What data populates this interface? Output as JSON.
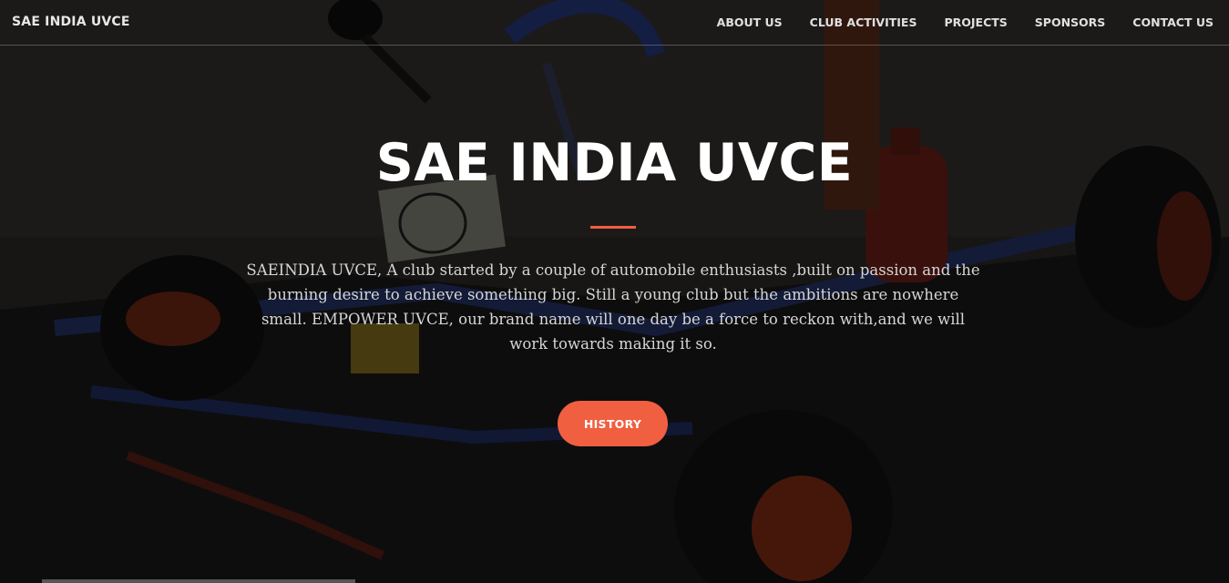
{
  "navbar": {
    "brand": "SAE INDIA UVCE",
    "links": [
      {
        "label": "ABOUT US"
      },
      {
        "label": "CLUB ACTIVITIES"
      },
      {
        "label": "PROJECTS"
      },
      {
        "label": "SPONSORS"
      },
      {
        "label": "CONTACT US"
      }
    ]
  },
  "hero": {
    "title": "SAE INDIA UVCE",
    "description": "SAEINDIA UVCE, A club started by a couple of automobile enthusiasts ,built on passion and the burning desire to achieve something big. Still a young club but the ambitions are nowhere small. EMPOWER UVCE, our brand name will one day be a force to reckon with,and we will work towards making it so.",
    "button_label": "HISTORY"
  },
  "colors": {
    "accent": "#f05f40",
    "text": "#ffffff"
  }
}
